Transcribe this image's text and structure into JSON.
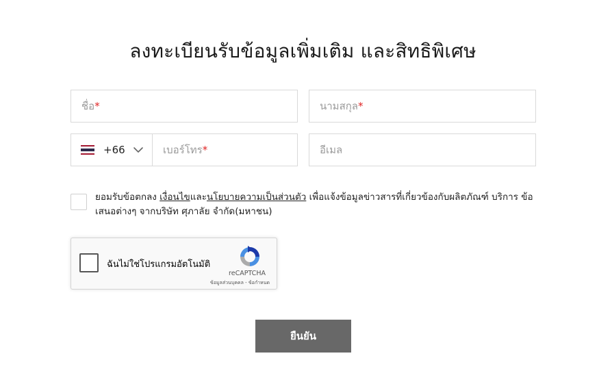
{
  "form": {
    "title": "ลงทะเบียนรับข้อมูลเพิ่มเติม และสิทธิพิเศษ",
    "first_name": {
      "placeholder": "ชื่อ",
      "required_mark": "*",
      "value": ""
    },
    "last_name": {
      "placeholder": "นามสกุล",
      "required_mark": "*",
      "value": ""
    },
    "phone": {
      "country_flag": "thailand-flag",
      "dial_code": "+66",
      "placeholder": "เบอร์โทร",
      "required_mark": "*",
      "value": ""
    },
    "email": {
      "placeholder": "อีเมล",
      "value": ""
    },
    "consent": {
      "checked": false,
      "text_before": "ยอมรับข้อตกลง ",
      "link_terms": "เงื่อนไข",
      "text_and": "และ",
      "link_privacy": "นโยบายความเป็นส่วนตัว",
      "text_after": " เพื่อแจ้งข้อมูลข่าวสารที่เกี่ยวข้องกับผลิตภัณฑ์ บริการ ข้อเสนอต่างๆ จากบริษัท ศุภาลัย จำกัด(มหาชน)"
    },
    "recaptcha": {
      "label": "ฉันไม่ใช่โปรแกรมอัตโนมัติ",
      "brand": "reCAPTCHA",
      "link_privacy": "ข้อมูลส่วนบุคคล",
      "separator": " - ",
      "link_terms": "ข้อกำหนด",
      "checked": false
    },
    "submit_label": "ยืนยัน",
    "colors": {
      "required": "#e02424",
      "submit_bg": "#686868",
      "border": "#d9d9d9"
    }
  }
}
